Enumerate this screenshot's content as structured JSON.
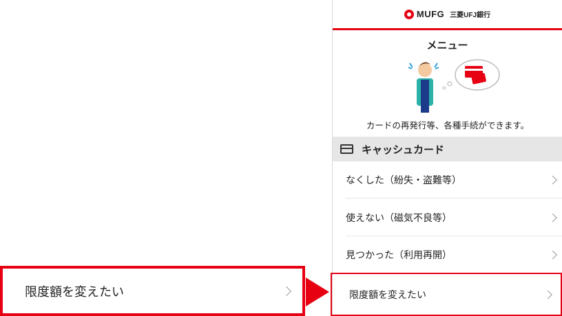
{
  "header": {
    "brand_short": "MUFG",
    "brand_bank": "三菱UFJ銀行"
  },
  "menu": {
    "title": "メニュー",
    "description": "カードの再発行等、各種手続ができます。"
  },
  "section": {
    "label": "キャッシュカード",
    "icon": "card-icon"
  },
  "items": [
    {
      "label": "なくした（紛失・盗難等）"
    },
    {
      "label": "使えない（磁気不良等）"
    },
    {
      "label": "見つかった（利用再開）"
    },
    {
      "label": "限度額を変えたい"
    }
  ],
  "callout": {
    "label": "限度額を変えたい"
  },
  "colors": {
    "accent": "#e60012",
    "section_bg": "#e6e6e6"
  }
}
